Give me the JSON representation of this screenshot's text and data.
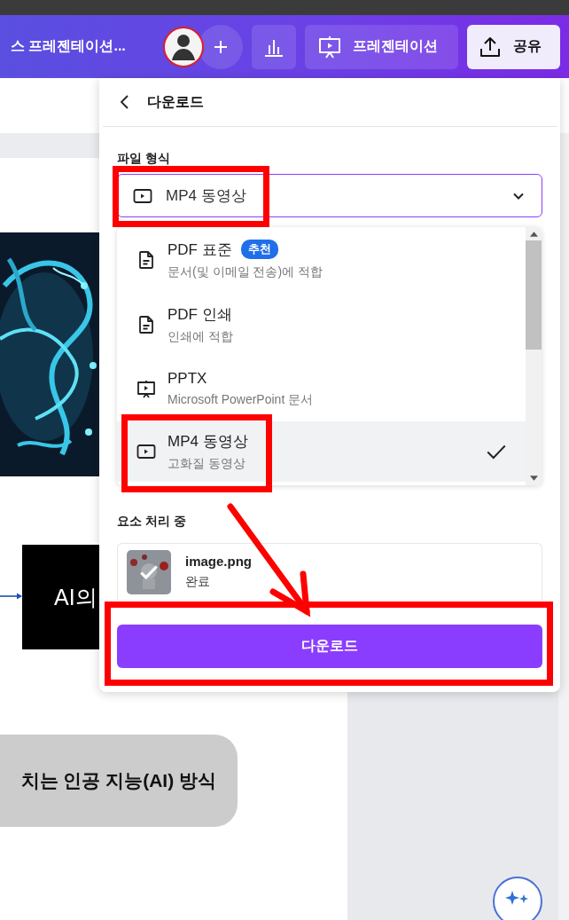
{
  "top_bar": {
    "title": "스 프레젠테이션...",
    "present_button": "프레젠테이션",
    "share_button": "공유"
  },
  "slide": {
    "box_text": "AI의",
    "pill_text": "치는 인공 지능(AI) 방식"
  },
  "download_panel": {
    "title": "다운로드",
    "file_type": {
      "label": "파일 형식",
      "value": "MP4 동영상",
      "kind": "video",
      "highlighted": true
    },
    "formats": [
      {
        "kind": "document",
        "name": "PDF 표준",
        "badge": "추천",
        "description": "문서(및 이메일 전송)에 적합",
        "selected": false,
        "highlighted": false
      },
      {
        "kind": "document",
        "name": "PDF 인쇄",
        "description": "인쇄에 적합",
        "selected": false,
        "highlighted": false
      },
      {
        "kind": "presentation",
        "name": "PPTX",
        "description": "Microsoft PowerPoint 문서",
        "selected": false,
        "highlighted": false
      },
      {
        "kind": "video",
        "name": "MP4 동영상",
        "description": "고화질 동영상",
        "selected": true,
        "highlighted": true
      }
    ],
    "processing": {
      "label": "요소 처리 중",
      "items": [
        {
          "name": "image.png",
          "status": "완료"
        }
      ]
    },
    "download_button": {
      "label": "다운로드",
      "highlighted": true
    }
  },
  "annotation_arrow": true
}
